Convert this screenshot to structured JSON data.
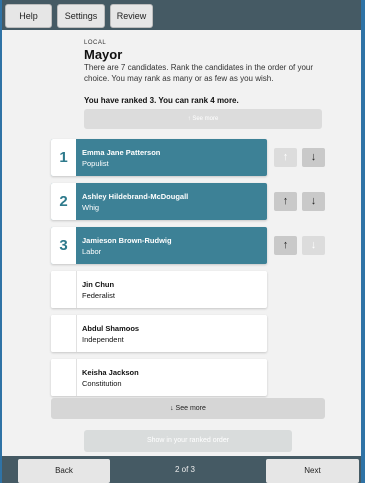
{
  "header": {
    "help_label": "Help",
    "settings_label": "Settings",
    "review_label": "Review"
  },
  "contest": {
    "type_label": "LOCAL",
    "title": "Mayor",
    "instructions": "There are 7 candidates. Rank the candidates in the order of your choice. You may rank as many or as few as you wish.",
    "ranked_summary": "You have ranked 3. You can rank 4 more."
  },
  "see_more_top_label": "↑ See more",
  "candidates": [
    {
      "rank": "1",
      "name": "Emma Jane Patterson",
      "party": "Populist"
    },
    {
      "rank": "2",
      "name": "Ashley Hildebrand-McDougall",
      "party": "Whig"
    },
    {
      "rank": "3",
      "name": "Jamieson Brown-Rudwig",
      "party": "Labor"
    },
    {
      "rank": "",
      "name": "Jin Chun",
      "party": "Federalist"
    },
    {
      "rank": "",
      "name": "Abdul Shamoos",
      "party": "Independent"
    },
    {
      "rank": "",
      "name": "Keisha Jackson",
      "party": "Constitution"
    }
  ],
  "move_up_glyph": "↑",
  "move_down_glyph": "↓",
  "see_more_bottom_label": "↓ See more",
  "show_ranked_order_label": "Show in your ranked order",
  "footer": {
    "back_label": "Back",
    "page_indicator": "2 of 3",
    "next_label": "Next"
  },
  "colors": {
    "ranked_row": "#3d8196",
    "bars": "#455a64",
    "border": "#2f73a6"
  }
}
